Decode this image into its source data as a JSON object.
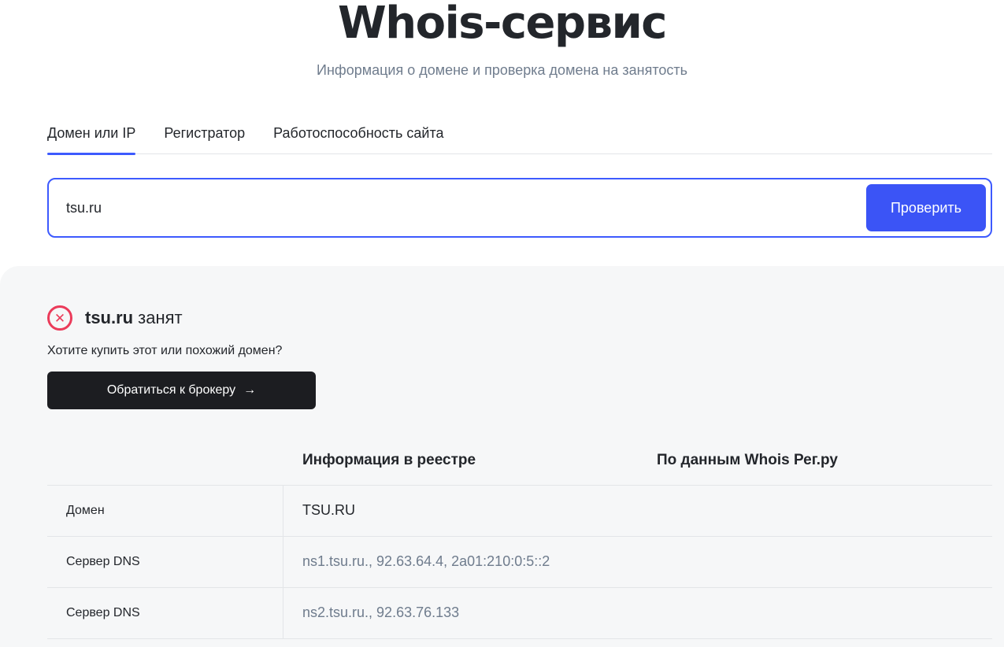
{
  "header": {
    "title": "Whois-сервис",
    "subtitle": "Информация о домене и проверка домена на занятость"
  },
  "tabs": [
    {
      "label": "Домен или IP",
      "active": true
    },
    {
      "label": "Регистратор",
      "active": false
    },
    {
      "label": "Работоспособность сайта",
      "active": false
    }
  ],
  "search": {
    "value": "tsu.ru",
    "button_label": "Проверить"
  },
  "result": {
    "domain": "tsu.ru",
    "status": "занят",
    "status_icon": "close-circle-icon",
    "status_color": "#eb3b5a",
    "buy_question": "Хотите купить этот или похожий домен?",
    "broker_button_label": "Обратиться к брокеру",
    "broker_button_arrow": "→"
  },
  "table": {
    "headers": [
      "",
      "Информация в реестре",
      "По данным Whois Рег.ру"
    ],
    "rows": [
      {
        "label": "Домен",
        "registry": "TSU.RU",
        "whois": ""
      },
      {
        "label": "Сервер DNS",
        "registry": "ns1.tsu.ru., 92.63.64.4, 2a01:210:0:5::2",
        "whois": ""
      },
      {
        "label": "Сервер DNS",
        "registry": "ns2.tsu.ru., 92.63.76.133",
        "whois": ""
      }
    ]
  },
  "colors": {
    "accent": "#3b54f6",
    "dark_button": "#1c1d21",
    "muted_text": "#6f7c8d"
  }
}
